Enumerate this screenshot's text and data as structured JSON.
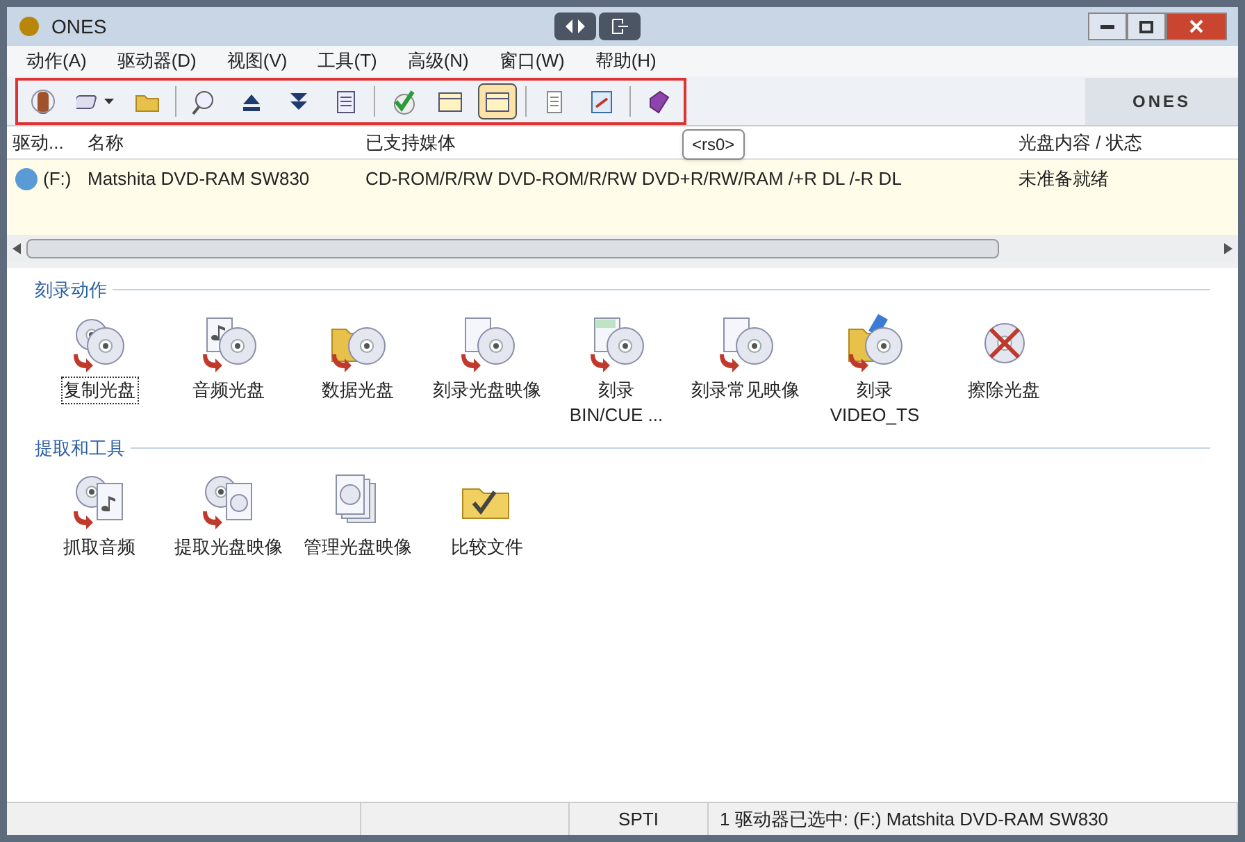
{
  "window": {
    "title": "ONES"
  },
  "menu": [
    "动作(A)",
    "驱动器(D)",
    "视图(V)",
    "工具(T)",
    "高级(N)",
    "窗口(W)",
    "帮助(H)"
  ],
  "toolbar": [
    {
      "kind": "button",
      "pressed": false
    },
    {
      "kind": "dropdown",
      "pressed": false
    },
    {
      "kind": "button",
      "pressed": false
    },
    {
      "kind": "separator"
    },
    {
      "kind": "button",
      "pressed": false
    },
    {
      "kind": "button",
      "pressed": false
    },
    {
      "kind": "button",
      "pressed": false
    },
    {
      "kind": "button",
      "pressed": false
    },
    {
      "kind": "separator"
    },
    {
      "kind": "button",
      "pressed": false
    },
    {
      "kind": "button",
      "pressed": false
    },
    {
      "kind": "button",
      "pressed": true
    },
    {
      "kind": "separator"
    },
    {
      "kind": "button",
      "pressed": false
    },
    {
      "kind": "button",
      "pressed": false
    },
    {
      "kind": "separator"
    },
    {
      "kind": "button",
      "pressed": false
    }
  ],
  "brand": "ONES",
  "tooltip": "<rs0>",
  "table": {
    "columns": [
      "驱动...",
      "名称",
      "已支持媒体",
      "光盘内容 / 状态"
    ],
    "rows": [
      {
        "drive": "(F:)",
        "name": "Matshita DVD-RAM SW830",
        "media": "CD-ROM/R/RW DVD-ROM/R/RW DVD+R/RW/RAM /+R DL /-R DL",
        "status": "未准备就绪"
      }
    ]
  },
  "sections": [
    {
      "title": "刻录动作",
      "items": [
        {
          "label": "复制光盘",
          "selected": true,
          "kind": "copy"
        },
        {
          "label": "音频光盘",
          "selected": false,
          "kind": "audio"
        },
        {
          "label": "数据光盘",
          "selected": false,
          "kind": "folder"
        },
        {
          "label": "刻录光盘映像",
          "selected": false,
          "kind": "image"
        },
        {
          "label": "刻录\nBIN/CUE ...",
          "selected": false,
          "kind": "cue"
        },
        {
          "label": "刻录常见映像",
          "selected": false,
          "kind": "image"
        },
        {
          "label": "刻录\nVIDEO_TS",
          "selected": false,
          "kind": "video"
        },
        {
          "label": "擦除光盘",
          "selected": false,
          "kind": "erase"
        }
      ]
    },
    {
      "title": "提取和工具",
      "items": [
        {
          "label": "抓取音频",
          "selected": false,
          "kind": "rip"
        },
        {
          "label": "提取光盘映像",
          "selected": false,
          "kind": "extract"
        },
        {
          "label": "管理光盘映像",
          "selected": false,
          "kind": "stack"
        },
        {
          "label": "比较文件",
          "selected": false,
          "kind": "compare"
        }
      ]
    }
  ],
  "status_bar": [
    "SPTI",
    "1 驱动器已选中: (F:) Matshita DVD-RAM SW830"
  ]
}
